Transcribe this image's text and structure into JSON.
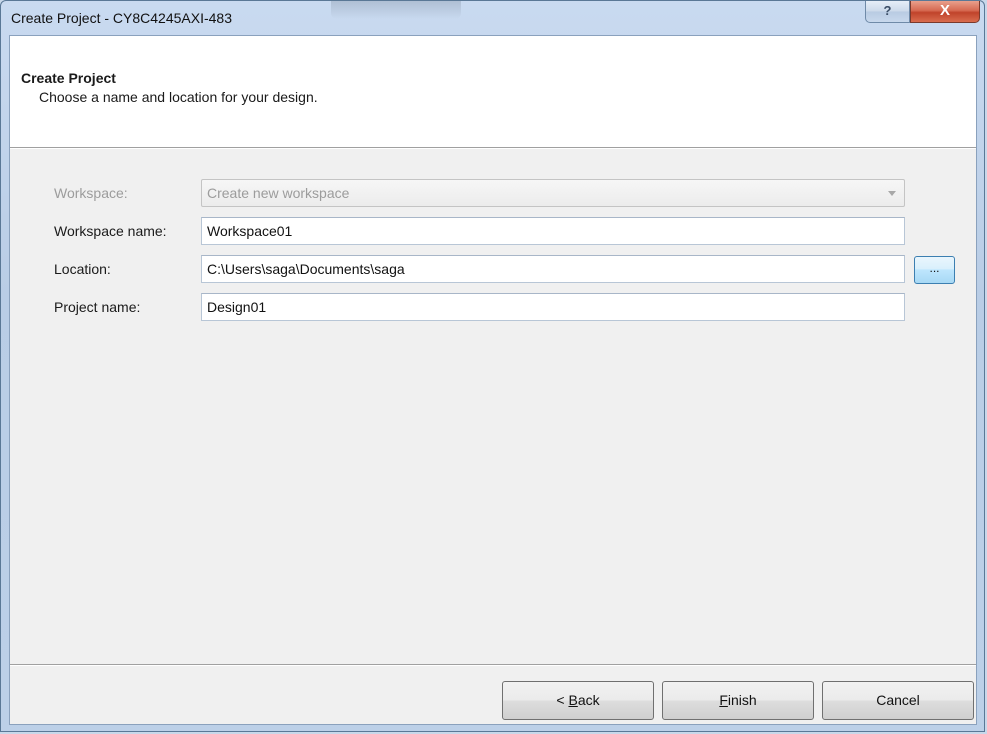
{
  "window": {
    "title": "Create Project - CY8C4245AXI-483",
    "help_glyph": "?",
    "close_glyph": "X"
  },
  "header": {
    "title": "Create Project",
    "subtitle": "Choose a name and location for your design."
  },
  "form": {
    "workspace": {
      "label": "Workspace:",
      "value": "Create new workspace",
      "disabled": true
    },
    "workspace_name": {
      "label": "Workspace name:",
      "value": "Workspace01"
    },
    "location": {
      "label": "Location:",
      "value": "C:\\Users\\saga\\Documents\\saga",
      "browse_label": "..."
    },
    "project_name": {
      "label": "Project name:",
      "value": "Design01"
    }
  },
  "buttons": {
    "back_prefix": "< ",
    "back_mnemonic": "B",
    "back_rest": "ack",
    "finish_mnemonic": "F",
    "finish_rest": "inish",
    "cancel": "Cancel"
  },
  "colors": {
    "titlebar": "#bcd0e8",
    "client_bg": "#f0f0f0",
    "header_bg": "#ffffff",
    "close_button": "#c7503a",
    "browse_button": "#bee6fd"
  }
}
